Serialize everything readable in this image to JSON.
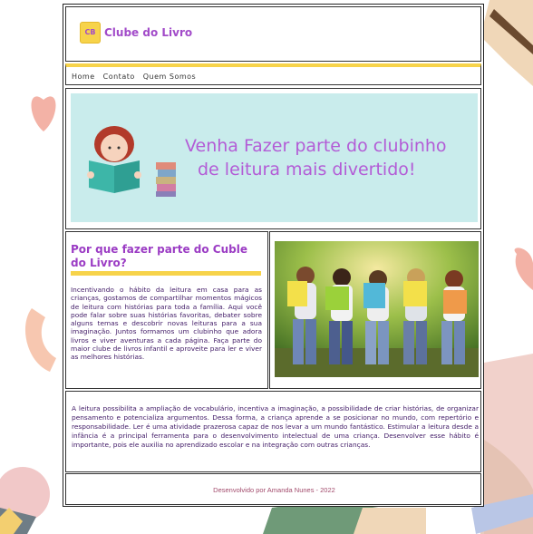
{
  "site": {
    "logo_mark": "CB",
    "logo_text": "Clube do Livro"
  },
  "nav": {
    "items": [
      {
        "label": "Home"
      },
      {
        "label": "Contato"
      },
      {
        "label": "Quem Somos"
      }
    ]
  },
  "banner": {
    "line1": "Venha Fazer parte do clubinho",
    "line2": "de leitura mais divertido!"
  },
  "why": {
    "title": "Por que fazer parte do Cuble do Livro?",
    "text": "Incentivando o hábito da leitura em casa para as crianças, gostamos de compartilhar momentos mágicos de leitura com histórias para toda a família. Aqui você pode falar sobre suas histórias favoritas, debater sobre alguns temas e descobrir novas leituras para a sua imaginação. Juntos formamos um clubinho que adora livros e viver aventuras a cada página. Faça parte do maior clube de livros infantil e aproveite para ler e viver as melhores histórias."
  },
  "info": {
    "text": "A leitura possibilita a ampliação de vocabulário, incentiva a imaginação, a possibilidade de criar histórias, de organizar pensamento e potencializa argumentos. Dessa forma, a criança aprende a se posicionar no mundo, com repertório e responsabilidade. Ler é uma atividade prazerosa capaz de nos levar a um mundo fantástico. Estimular a leitura desde a infância é a principal ferramenta para o desenvolvimento intelectual de uma criança. Desenvolver esse hábito é importante, pois ele auxilia no aprendizado escolar e na integração com outras crianças."
  },
  "footer": {
    "text": "Desenvolvido por Amanda Nunes - 2022"
  },
  "colors": {
    "accent": "#a24bc9",
    "highlight": "#f7d34a",
    "banner_bg": "#c9ecec"
  }
}
